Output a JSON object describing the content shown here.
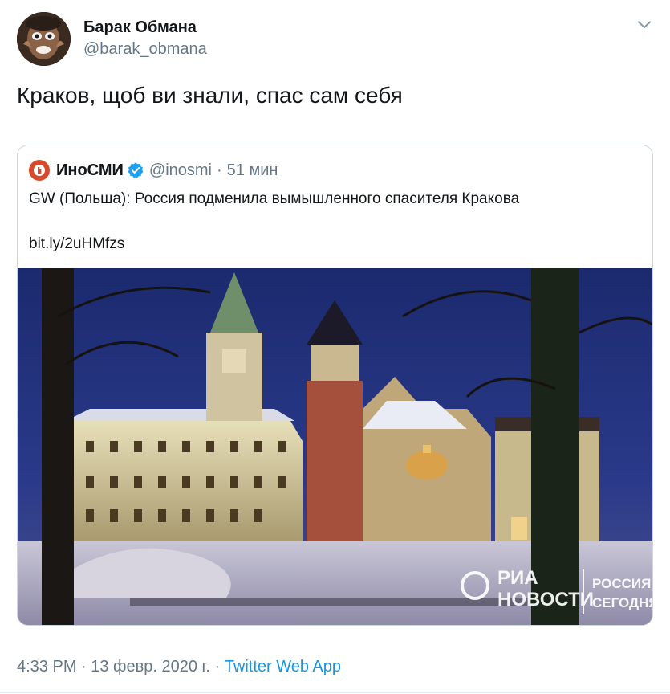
{
  "tweet": {
    "author_name": "Барак Обмана",
    "author_handle": "@barak_obmana",
    "text": "Краков, щоб ви знали, спас сам себя",
    "quoted": {
      "author_name": "ИноСМИ",
      "author_handle": "@inosmi",
      "separator": "·",
      "time": "51 мин",
      "text": "GW (Польша): Россия подменила вымышленного спасителя Кракова",
      "link": "bit.ly/2uHMfzs",
      "watermark": {
        "ria_line1": "РИА",
        "ria_line2": "НОВОСТИ",
        "rs_line1": "РОССИЯ",
        "rs_line2": "СЕГОДНЯ"
      }
    },
    "timestamp": "4:33 PM · 13 февр. 2020 г.",
    "meta_separator": "·",
    "source_app": "Twitter Web App"
  },
  "colors": {
    "link": "#1b95e0",
    "secondary": "#657786",
    "verified": "#1da1f2"
  },
  "icons": {
    "caret": "chevron-down-icon",
    "verified": "verified-badge-icon"
  }
}
